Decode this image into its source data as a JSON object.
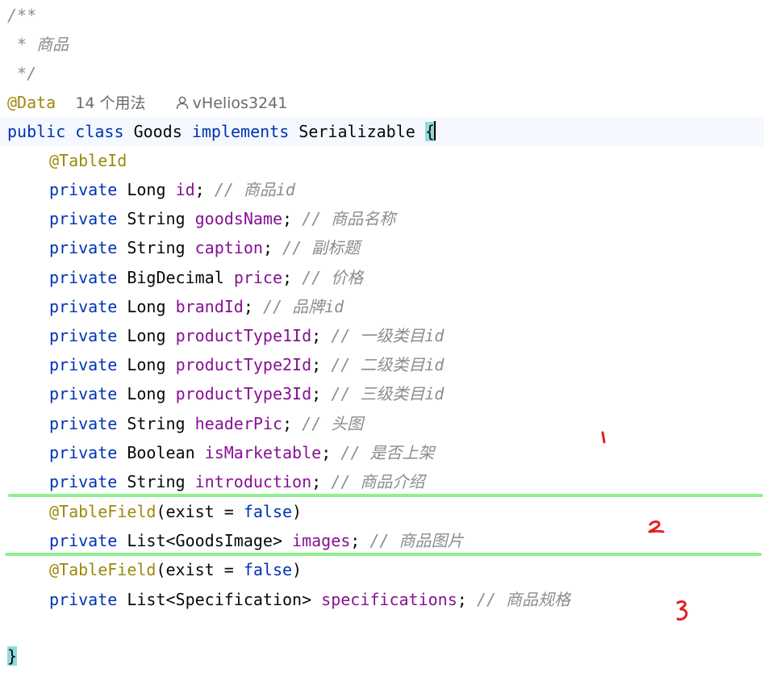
{
  "code": {
    "doc_open": "/**",
    "doc_body": " * 商品",
    "doc_close": " */",
    "annotation_data": "@Data",
    "usages": "14 个用法",
    "author": "vHelios3241",
    "class_decl": {
      "kw_public": "public",
      "kw_class": "class",
      "name": "Goods",
      "kw_implements": "implements",
      "iface": "Serializable",
      "brace": "{"
    },
    "annotation_tableid": "@TableId",
    "fields": [
      {
        "mod": "private",
        "type": "Long",
        "name": "id",
        "comment": "// 商品id"
      },
      {
        "mod": "private",
        "type": "String",
        "name": "goodsName",
        "comment": "// 商品名称"
      },
      {
        "mod": "private",
        "type": "String",
        "name": "caption",
        "comment": "// 副标题"
      },
      {
        "mod": "private",
        "type": "BigDecimal",
        "name": "price",
        "comment": "// 价格"
      },
      {
        "mod": "private",
        "type": "Long",
        "name": "brandId",
        "comment": "// 品牌id"
      },
      {
        "mod": "private",
        "type": "Long",
        "name": "productType1Id",
        "comment": "// 一级类目id"
      },
      {
        "mod": "private",
        "type": "Long",
        "name": "productType2Id",
        "comment": "// 二级类目id"
      },
      {
        "mod": "private",
        "type": "Long",
        "name": "productType3Id",
        "comment": "// 三级类目id"
      },
      {
        "mod": "private",
        "type": "String",
        "name": "headerPic",
        "comment": "// 头图"
      },
      {
        "mod": "private",
        "type": "Boolean",
        "name": "isMarketable",
        "comment": "// 是否上架"
      },
      {
        "mod": "private",
        "type": "String",
        "name": "introduction",
        "comment": "// 商品介绍"
      }
    ],
    "tablefield_1": {
      "ann": "@TableField",
      "args_pre": "(exist = ",
      "value": "false",
      "args_post": ")"
    },
    "images_field": {
      "mod": "private",
      "type": "List<GoodsImage>",
      "name": "images",
      "comment": "// 商品图片"
    },
    "tablefield_2": {
      "ann": "@TableField",
      "args_pre": "(exist = ",
      "value": "false",
      "args_post": ")"
    },
    "specs_field": {
      "mod": "private",
      "type": "List<Specification>",
      "name": "specifications",
      "comment": "// 商品规格"
    },
    "closing_brace": "}"
  },
  "markers": [
    "1",
    "2",
    "3"
  ],
  "colors": {
    "keyword": "#0033b3",
    "annotation": "#9e880d",
    "field": "#871094",
    "comment": "#8c8c8c",
    "divider": "#8ff08f",
    "marker": "#e02020"
  }
}
